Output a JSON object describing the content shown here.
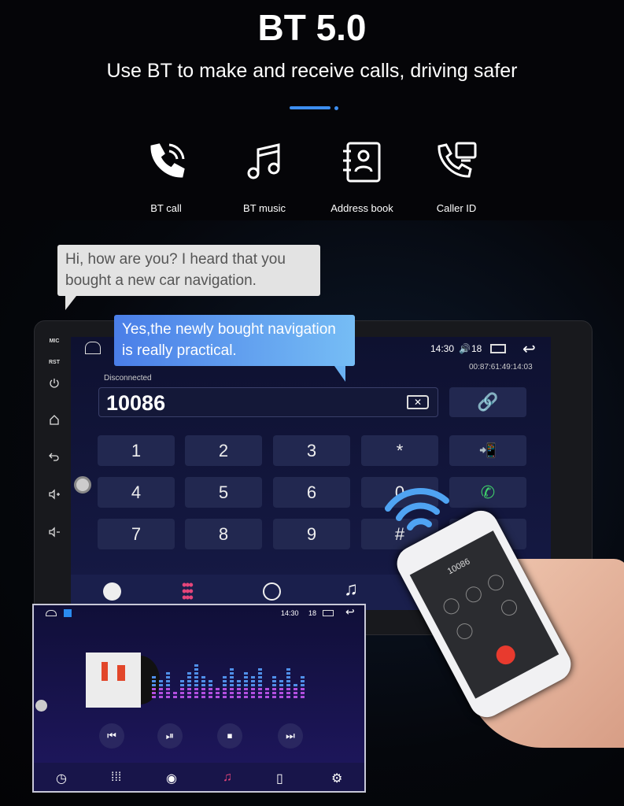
{
  "header": {
    "title": "BT 5.0",
    "subtitle": "Use BT to make and receive calls, driving safer",
    "accent": "#3d8ef0"
  },
  "features": [
    {
      "label": "BT call",
      "icon": "phone-icon"
    },
    {
      "label": "BT music",
      "icon": "music-note-icon"
    },
    {
      "label": "Address book",
      "icon": "address-book-icon"
    },
    {
      "label": "Caller ID",
      "icon": "caller-id-icon"
    }
  ],
  "bubbles": {
    "question": "Hi, how are you? I heard that you bought a new car navigation.",
    "answer": "Yes,the newly bought navigation is really practical."
  },
  "unit": {
    "side": {
      "mic": "MIC",
      "rst": "RST"
    }
  },
  "dialer": {
    "time": "14:30",
    "volume": "18",
    "status": "Disconnected",
    "mac": "00:87:61:49:14:03",
    "number": "10086",
    "keys": [
      "1",
      "2",
      "3",
      "*",
      "4",
      "5",
      "6",
      "0",
      "7",
      "8",
      "9",
      "#"
    ]
  },
  "music": {
    "time": "14:30",
    "volume": "18"
  },
  "phone": {
    "number": "10086",
    "end_color": "#e83a2e"
  }
}
